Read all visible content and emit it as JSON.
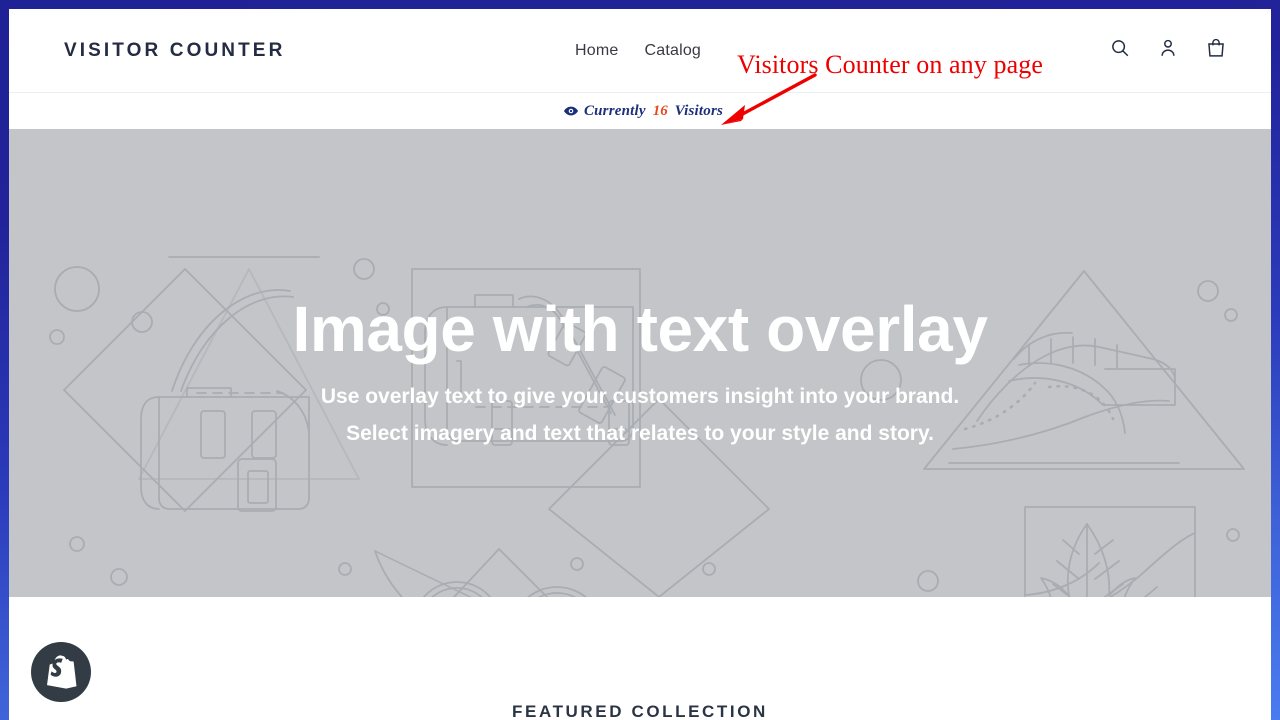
{
  "browser": {
    "frame_color_top": "#1f2196",
    "frame_color_bottom": "#4a7bf0"
  },
  "header": {
    "logo": "VISITOR COUNTER",
    "nav": [
      {
        "label": "Home",
        "name": "nav-link-home"
      },
      {
        "label": "Catalog",
        "name": "nav-link-catalog"
      }
    ],
    "icons": [
      {
        "name": "search-icon",
        "title": "Search"
      },
      {
        "name": "account-icon",
        "title": "Log in"
      },
      {
        "name": "cart-icon",
        "title": "Cart"
      }
    ]
  },
  "visitor_counter": {
    "icon": "eye-icon",
    "prefix": "Currently",
    "count": "16",
    "suffix": "Visitors",
    "text_color": "#1b2f7a",
    "count_color": "#e8491d"
  },
  "annotation": {
    "text": "Visitors Counter on any page",
    "color": "#ee0000",
    "arrow": "arrow-down-left"
  },
  "hero": {
    "title": "Image with text overlay",
    "subtitle_line1": "Use overlay text to give your customers insight into your brand.",
    "subtitle_line2": "Select imagery and text that relates to your style and story.",
    "background_color": "#c3c5c8",
    "art_line_color": "#a7abb0"
  },
  "below_hero": {
    "featured_heading": "FEATURED COLLECTION",
    "shopify_badge": "shopify-logo-icon"
  }
}
